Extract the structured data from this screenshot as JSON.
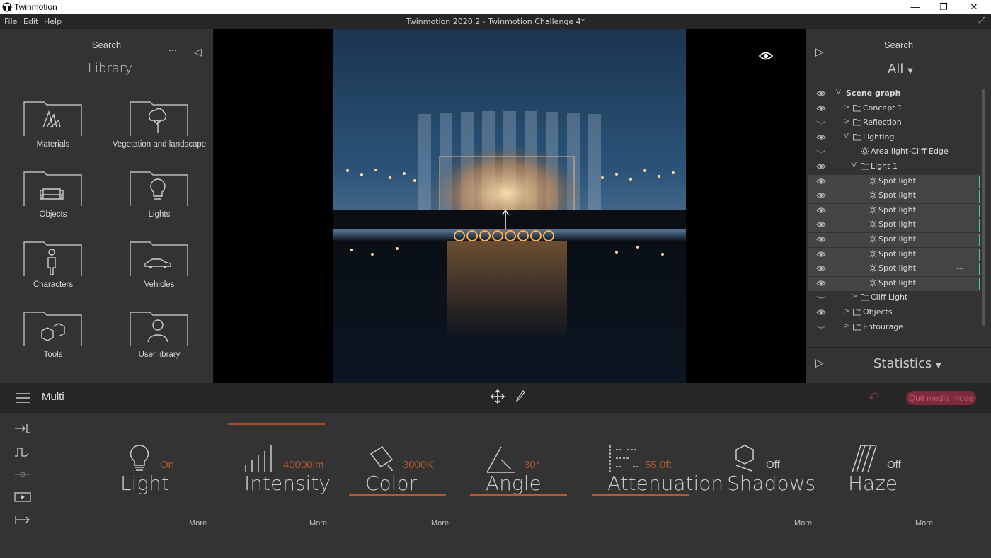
{
  "window": {
    "app_name": "Twinmotion",
    "minimize": "—",
    "maximize": "❐",
    "close": "✕"
  },
  "menu": {
    "file": "File",
    "edit": "Edit",
    "help": "Help",
    "doc_title": "Twinmotion 2020.2 - Twinmotion Challenge 4*",
    "expand": "⤢"
  },
  "library": {
    "search": "Search",
    "more": "...",
    "collapse": "◁",
    "heading": "Library",
    "items": [
      {
        "label": "Materials",
        "icon": "materials-icon"
      },
      {
        "label": "Vegetation and landscape",
        "icon": "tree-icon"
      },
      {
        "label": "Objects",
        "icon": "sofa-icon"
      },
      {
        "label": "Lights",
        "icon": "bulb-icon"
      },
      {
        "label": "Characters",
        "icon": "person-icon"
      },
      {
        "label": "Vehicles",
        "icon": "car-icon"
      },
      {
        "label": "Tools",
        "icon": "cubes-icon"
      },
      {
        "label": "User library",
        "icon": "user-icon"
      }
    ]
  },
  "scene": {
    "expand": "▷",
    "search": "Search",
    "filter": "All",
    "rows": [
      {
        "label": "Scene graph",
        "eye": "open",
        "chev": "V",
        "depth": 0,
        "icon": "none",
        "bold": true
      },
      {
        "label": "Concept 1",
        "eye": "open",
        "chev": ">",
        "depth": 1,
        "icon": "folder"
      },
      {
        "label": "Reflection",
        "eye": "closed",
        "chev": ">",
        "depth": 1,
        "icon": "folder"
      },
      {
        "label": "Lighting",
        "eye": "open",
        "chev": "V",
        "depth": 1,
        "icon": "folder"
      },
      {
        "label": "Area light-Cliff Edge",
        "eye": "closed",
        "chev": "",
        "depth": 2,
        "icon": "light"
      },
      {
        "label": "Light 1",
        "eye": "open",
        "chev": "V",
        "depth": 2,
        "icon": "folder"
      },
      {
        "label": "Spot light",
        "eye": "open",
        "chev": "",
        "depth": 3,
        "icon": "light",
        "selected": true
      },
      {
        "label": "Spot light",
        "eye": "open",
        "chev": "",
        "depth": 3,
        "icon": "light",
        "selected": true
      },
      {
        "label": "Spot light",
        "eye": "open",
        "chev": "",
        "depth": 3,
        "icon": "light",
        "selected": true
      },
      {
        "label": "Spot light",
        "eye": "open",
        "chev": "",
        "depth": 3,
        "icon": "light",
        "selected": true
      },
      {
        "label": "Spot light",
        "eye": "open",
        "chev": "",
        "depth": 3,
        "icon": "light",
        "selected": true
      },
      {
        "label": "Spot light",
        "eye": "open",
        "chev": "",
        "depth": 3,
        "icon": "light",
        "selected": true
      },
      {
        "label": "Spot light",
        "eye": "open",
        "chev": "",
        "depth": 3,
        "icon": "light",
        "selected": true,
        "more": "..."
      },
      {
        "label": "Spot light",
        "eye": "open",
        "chev": "",
        "depth": 3,
        "icon": "light",
        "selected": true
      },
      {
        "label": "Cliff Light",
        "eye": "closed",
        "chev": ">",
        "depth": 2,
        "icon": "folder"
      },
      {
        "label": "Objects",
        "eye": "open",
        "chev": ">",
        "depth": 1,
        "icon": "folder"
      },
      {
        "label": "Entourage",
        "eye": "closed",
        "chev": ">",
        "depth": 1,
        "icon": "folder"
      }
    ],
    "statistics_expand": "▷",
    "statistics": "Statistics"
  },
  "toolbar": {
    "mode": "Multi",
    "quit": "Quit media mode",
    "undo": "↶"
  },
  "properties": {
    "light": {
      "name": "Light",
      "value": "On"
    },
    "intensity": {
      "name": "Intensity",
      "value": "40000lm"
    },
    "color": {
      "name": "Color",
      "value": "3000K"
    },
    "angle": {
      "name": "Angle",
      "value": "30°"
    },
    "attenuation": {
      "name": "Attenuation",
      "value": "55.0ft"
    },
    "shadows": {
      "name": "Shadows",
      "value": "Off"
    },
    "haze": {
      "name": "Haze",
      "value": "Off"
    },
    "more": "More"
  },
  "colors": {
    "accent": "#b25b33",
    "quit_bg": "#7a2b3e",
    "selection_bar": "#3fd0a0"
  }
}
